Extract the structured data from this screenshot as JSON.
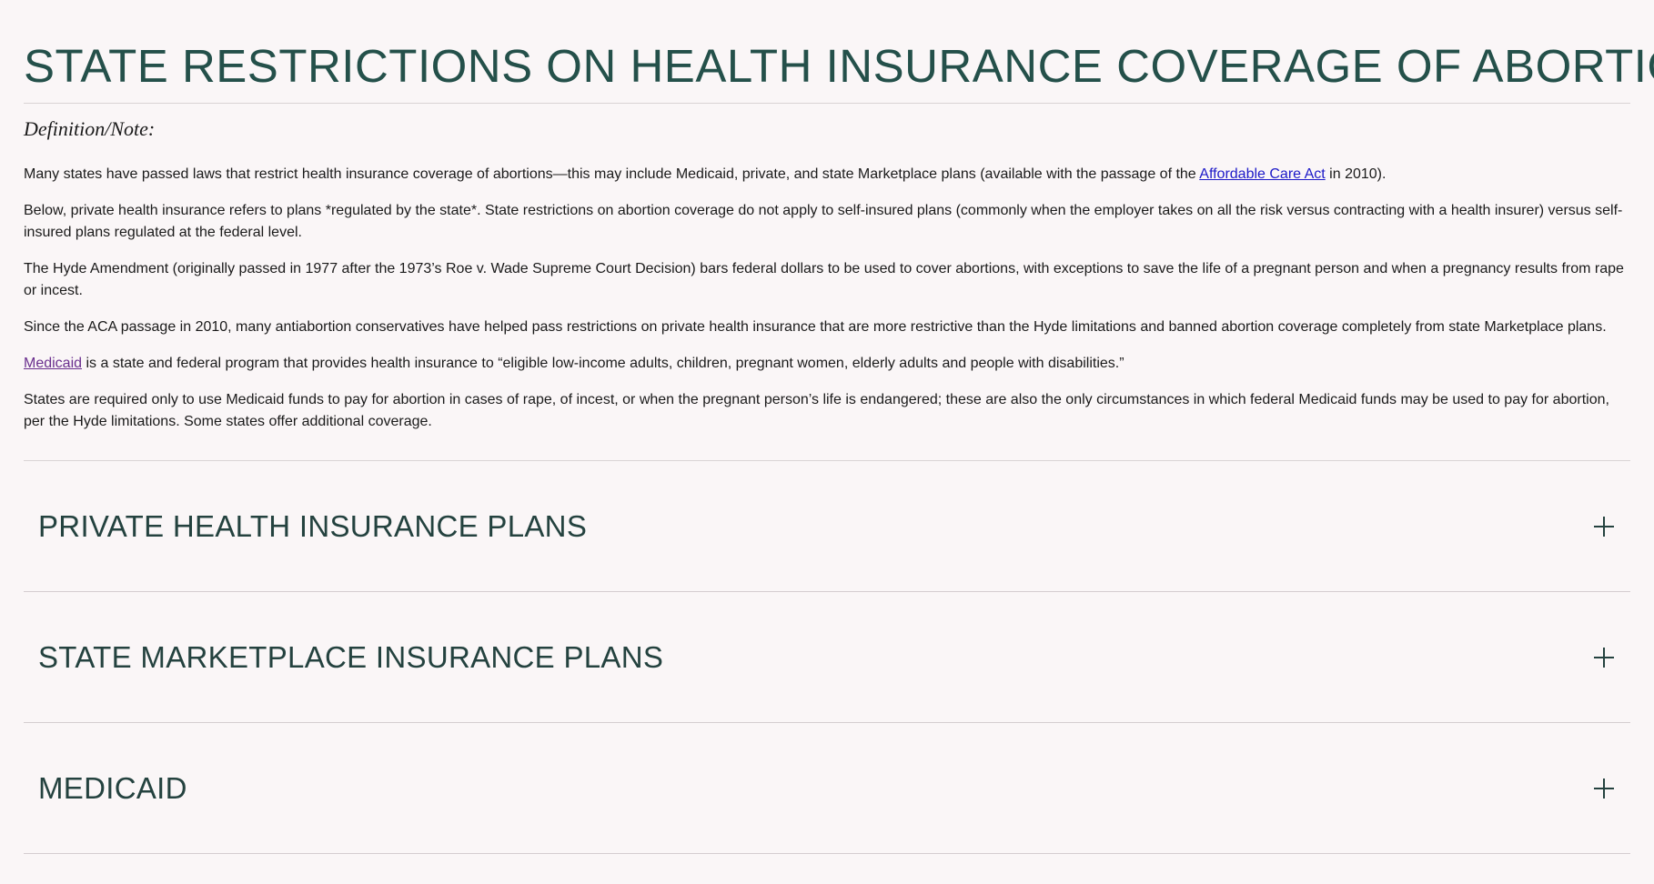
{
  "page": {
    "title": "STATE RESTRICTIONS ON HEALTH INSURANCE COVERAGE OF ABORTION",
    "note_heading": "Definition/Note:"
  },
  "paragraphs": {
    "p1_before": "Many states have passed laws that restrict health insurance coverage of abortions—this may include Medicaid, private, and state Marketplace plans (available with the passage of the ",
    "p1_link": "Affordable Care Act",
    "p1_after": " in 2010).",
    "p2": "Below, private health insurance refers to plans *regulated by the state*. State restrictions on abortion coverage do not apply to self-insured plans (commonly when the employer takes on all the risk versus contracting with a health insurer) versus self-insured plans regulated at the federal level.",
    "p3": "The Hyde Amendment (originally passed in 1977 after the 1973’s Roe v. Wade Supreme Court Decision) bars federal dollars to be used to cover abortions, with exceptions to save the life of a pregnant person and when a pregnancy results from rape or incest.",
    "p4": "Since the ACA passage in 2010, many antiabortion conservatives have helped pass restrictions on private health insurance that are more restrictive than the Hyde limitations and banned abortion coverage completely from state Marketplace plans.",
    "p5_link": "Medicaid",
    "p5_after": " is a state and federal program that provides health insurance to “eligible low-income adults, children, pregnant women, elderly adults and people with disabilities.”",
    "p6": "States are required only to use Medicaid funds to pay for abortion in cases of rape, of incest, or when the pregnant person’s life is endangered; these are also the only circumstances in which federal Medicaid funds may be used to pay for abortion, per the Hyde limitations. Some states offer additional coverage."
  },
  "accordion": [
    {
      "label": "PRIVATE HEALTH INSURANCE PLANS",
      "icon": "plus-icon"
    },
    {
      "label": "STATE MARKETPLACE INSURANCE PLANS",
      "icon": "plus-icon"
    },
    {
      "label": "MEDICAID",
      "icon": "plus-icon"
    }
  ],
  "colors": {
    "background": "#faf6f7",
    "heading": "#24504a",
    "accordion_text": "#24423f",
    "link": "#1d1ac8",
    "visited_link": "#6a2f8e"
  }
}
